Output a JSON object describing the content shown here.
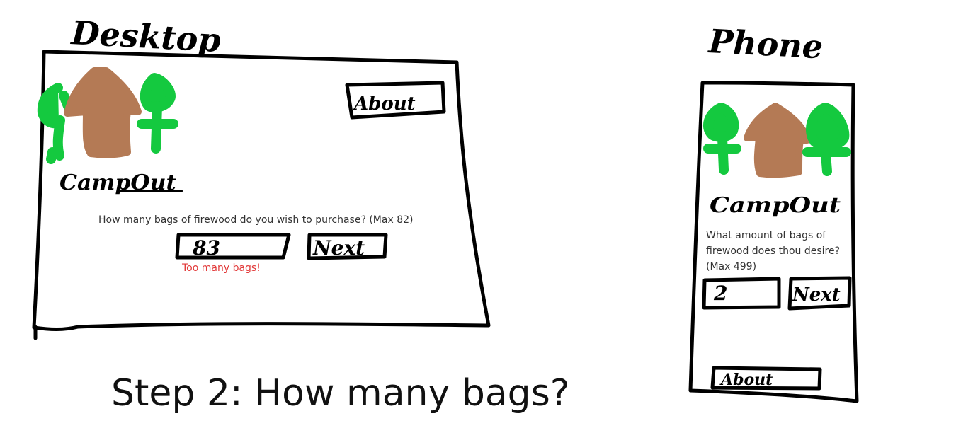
{
  "desktop": {
    "label": "Desktop",
    "logo_text": "CampOut",
    "about_label": "About",
    "question": "How many bags of firewood do you wish to purchase? (Max 82)",
    "input_value": "83",
    "next_label": "Next",
    "error_message": "Too many bags!"
  },
  "phone": {
    "label": "Phone",
    "logo_text": "CampOut",
    "question": "What amount of bags of firewood does thou desire? (Max 499)",
    "input_value": "2",
    "next_label": "Next",
    "about_label": "About"
  },
  "caption": "Step 2: How many bags?",
  "colors": {
    "tree": "#14c93f",
    "house": "#b47a55",
    "error": "#e23a3a"
  }
}
